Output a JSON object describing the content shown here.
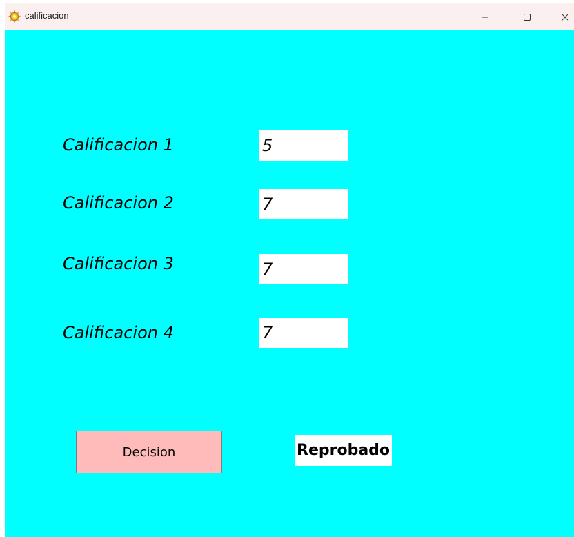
{
  "window": {
    "title": "calificacion",
    "icon": "sun-gear-icon"
  },
  "form": {
    "grades": [
      {
        "label": "Calificacion 1",
        "value": "5"
      },
      {
        "label": "Calificacion 2",
        "value": "7"
      },
      {
        "label": "Calificacion 3",
        "value": "7"
      },
      {
        "label": "Calificacion 4",
        "value": "7"
      }
    ],
    "decision_label": "Decision",
    "result": "Reprobado"
  },
  "colors": {
    "background": "#00ffff",
    "titlebar": "#fbeff0",
    "button": "#ffbaba",
    "field": "#ffffff"
  }
}
